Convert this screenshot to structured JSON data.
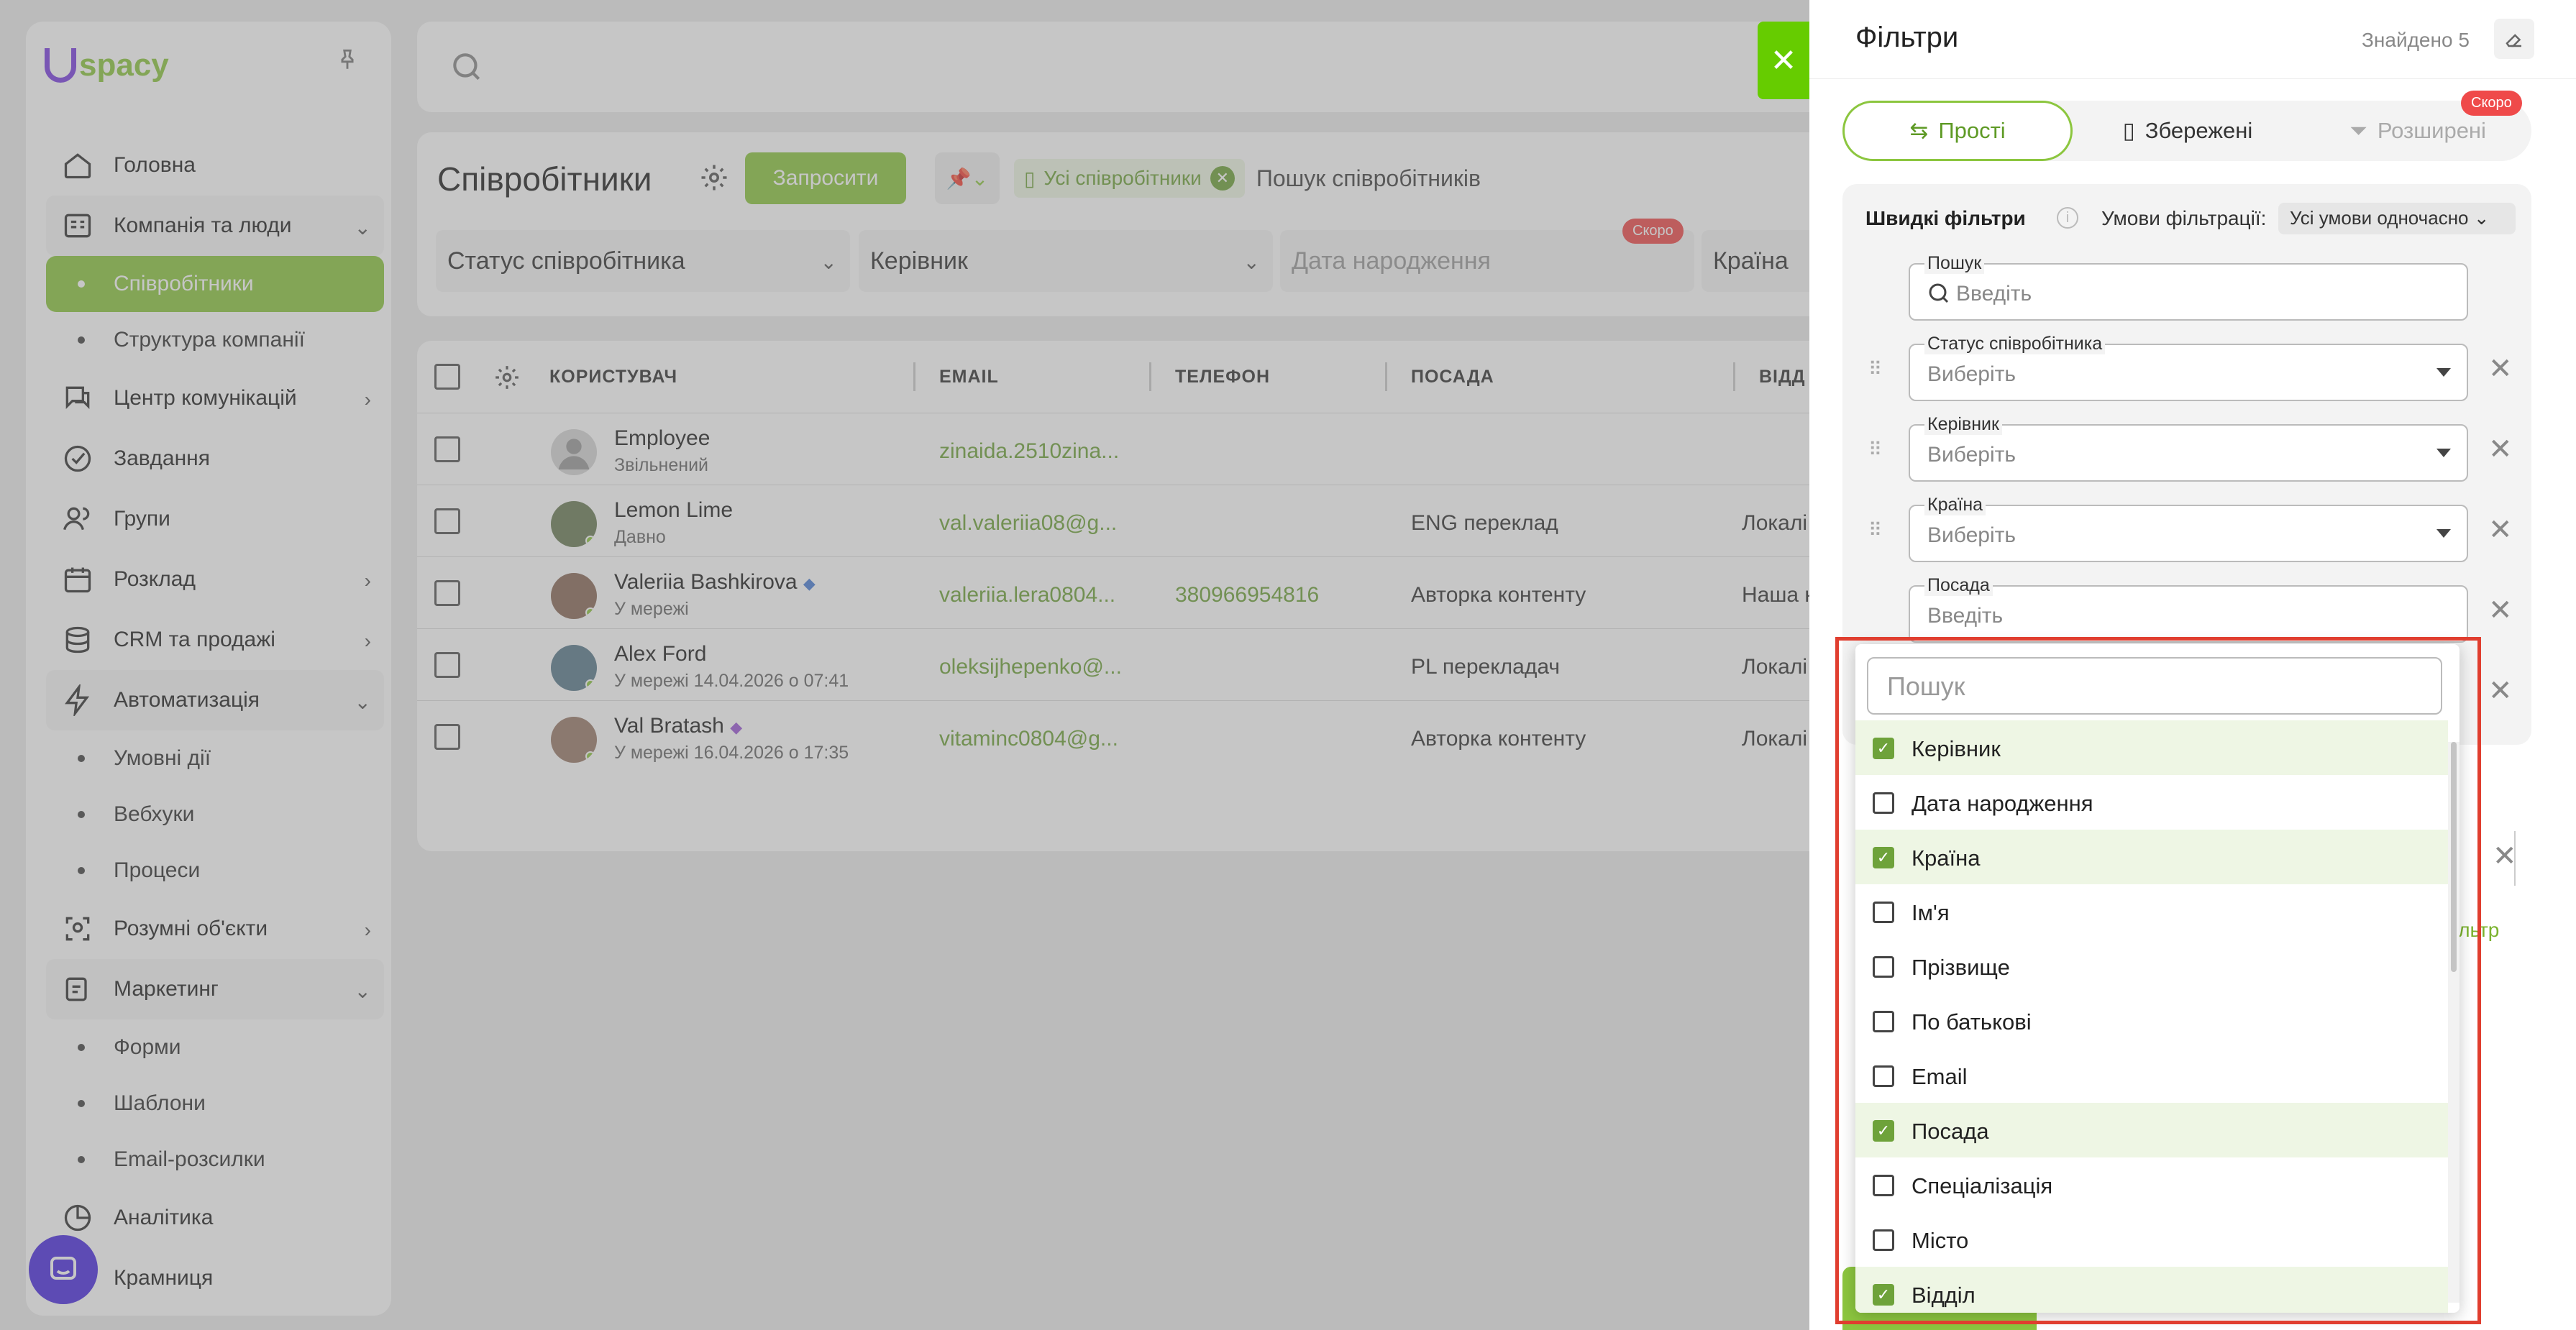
{
  "app": {
    "logo_text": "spacy",
    "logo_color": "#7a3fe0",
    "accent": "#8cc63f"
  },
  "sidebar": {
    "items": [
      {
        "label": "Головна",
        "icon": "home-icon"
      },
      {
        "label": "Компанія та люди",
        "icon": "company-icon"
      },
      {
        "label": "Співробітники",
        "icon": "dot"
      },
      {
        "label": "Структура компанії",
        "icon": "dot"
      },
      {
        "label": "Центр комунікацій",
        "icon": "chat-icon"
      },
      {
        "label": "Завдання",
        "icon": "check-circle-icon"
      },
      {
        "label": "Групи",
        "icon": "users-icon"
      },
      {
        "label": "Розклад",
        "icon": "calendar-icon"
      },
      {
        "label": "CRM та продажі",
        "icon": "database-icon"
      },
      {
        "label": "Автоматизація",
        "icon": "bolt-icon"
      },
      {
        "label": "Умовні дії",
        "icon": "dot"
      },
      {
        "label": "Вебхуки",
        "icon": "dot"
      },
      {
        "label": "Процеси",
        "icon": "dot"
      },
      {
        "label": "Розумні об'єкти",
        "icon": "scan-icon"
      },
      {
        "label": "Маркетинг",
        "icon": "marketing-icon"
      },
      {
        "label": "Форми",
        "icon": "dot"
      },
      {
        "label": "Шаблони",
        "icon": "dot"
      },
      {
        "label": "Email-розсилки",
        "icon": "dot"
      },
      {
        "label": "Аналітика",
        "icon": "analytics-icon"
      },
      {
        "label": "Крамниця",
        "icon": "shop-icon"
      }
    ]
  },
  "page": {
    "title": "Співробітники",
    "invite_label": "Запросити",
    "tag_label": "Усі співробітники",
    "search_placeholder": "Пошук співробітників",
    "filters": {
      "status": "Статус співробітника",
      "manager": "Керівник",
      "birth": "Дата народження",
      "country": "Країна",
      "soon": "Скоро"
    }
  },
  "table": {
    "columns": [
      "КОРИСТУВАЧ",
      "EMAIL",
      "ТЕЛЕФОН",
      "ПОСАДА",
      "ВІДД"
    ],
    "rows": [
      {
        "name": "Employee",
        "status": "Звільнений",
        "email": "zinaida.2510zina...",
        "phone": "",
        "position": "",
        "dept": ""
      },
      {
        "name": "Lemon Lime",
        "status": "Давно",
        "email": "val.valeriia08@g...",
        "phone": "",
        "position": "ENG переклад",
        "dept": "Локалі"
      },
      {
        "name": "Valeriia Bashkirova",
        "status": "У мережі",
        "email": "valeriia.lera0804...",
        "phone": "380966954816",
        "position": "Авторка контенту",
        "dept": "Наша к"
      },
      {
        "name": "Alex Ford",
        "status": "У мережі 14.04.2026 о 07:41",
        "email": "oleksijhepenko@...",
        "phone": "",
        "position": "PL перекладач",
        "dept": "Локалі"
      },
      {
        "name": "Val Bratash",
        "status": "У мережі 16.04.2026 о 17:35",
        "email": "vitaminc0804@g...",
        "phone": "",
        "position": "Авторка контенту",
        "dept": "Локалі"
      }
    ]
  },
  "panel": {
    "title": "Фільтри",
    "found": "Знайдено 5",
    "tabs": {
      "simple": "Прості",
      "saved": "Збережені",
      "advanced": "Розширені",
      "soon": "Скоро"
    },
    "quick_title": "Швидкі фільтри",
    "conditions_label": "Умови фільтрації:",
    "conditions_value": "Усі умови одночасно",
    "fields": [
      {
        "label": "Пошук",
        "value": "Введіть"
      },
      {
        "label": "Статус співробітника",
        "value": "Виберіть"
      },
      {
        "label": "Керівник",
        "value": "Виберіть"
      },
      {
        "label": "Країна",
        "value": "Виберіть"
      },
      {
        "label": "Посада",
        "value": "Введіть"
      }
    ],
    "add_filter_fragment": "ільтр"
  },
  "dropdown": {
    "search_placeholder": "Пошук",
    "options": [
      {
        "label": "Керівник",
        "checked": true
      },
      {
        "label": "Дата народження",
        "checked": false
      },
      {
        "label": "Країна",
        "checked": true
      },
      {
        "label": "Ім'я",
        "checked": false
      },
      {
        "label": "Прізвище",
        "checked": false
      },
      {
        "label": "По батькові",
        "checked": false
      },
      {
        "label": "Email",
        "checked": false
      },
      {
        "label": "Посада",
        "checked": true
      },
      {
        "label": "Спеціалізація",
        "checked": false
      },
      {
        "label": "Місто",
        "checked": false
      },
      {
        "label": "Відділ",
        "checked": true
      }
    ]
  }
}
